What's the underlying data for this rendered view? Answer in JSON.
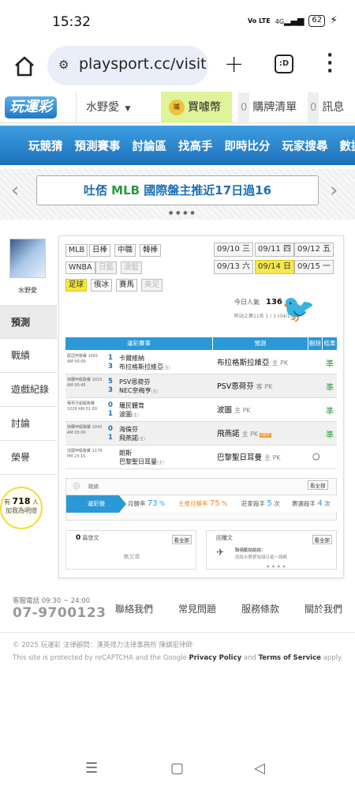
{
  "status_bar": {
    "time": "15:32",
    "network": "Vo LTE",
    "signal": "4G",
    "battery": "62"
  },
  "browser": {
    "url": "playsport.cc/visit",
    "new_tab": "+",
    "tabs": ":D",
    "menu": "⋮"
  },
  "site_header": {
    "logo": "玩運彩",
    "user_select": "水野愛",
    "buy_coin": "買噱幣",
    "coin_icon": "噱",
    "cart_count": "0",
    "cart_label": "購牌清單",
    "msg_count": "0",
    "msg_label": "訊息"
  },
  "nav": {
    "items": [
      "玩競猜",
      "預測賽事",
      "討論區",
      "找高手",
      "即時比分",
      "玩家搜尋",
      "數據"
    ]
  },
  "banner": {
    "prefix": "吐俖 ",
    "highlight": "MLB",
    "text": " 國際盤主推近17日過16",
    "dots": "● ● ● ●"
  },
  "sidebar": {
    "username": "水野愛",
    "tabs": [
      "預測",
      "戰績",
      "遊戲紀錄",
      "討論",
      "榮譽"
    ],
    "bulb_prefix": "有",
    "bulb_count": "718",
    "bulb_suffix": "人",
    "bulb_text": "加我為明燈"
  },
  "leagues": {
    "row1": [
      "MLB",
      "日棒",
      "中職",
      "韓棒"
    ],
    "row2": [
      "WNBA",
      "日籃",
      "澳籃"
    ],
    "row3": [
      "足球",
      "俄冰",
      "賽馬",
      "美足"
    ]
  },
  "dates": {
    "row1": [
      "09/10 三",
      "09/11 四",
      "09/12 五"
    ],
    "row2": [
      "09/13 六",
      "09/14 日",
      "09/15 一"
    ]
  },
  "popularity": {
    "label": "今日人氣",
    "value": "136",
    "rank": "昨站上第11名 1 / 1 (04/15/4)"
  },
  "table": {
    "headers": [
      "運彩賽事",
      "預測",
      "刪除",
      "結果"
    ],
    "rows": [
      {
        "league": "歐冠杯聯賽 1001 AM 00:00",
        "s1": "1",
        "s2": "3",
        "t1": "卡爾維納",
        "t2": "布拉格斯拉維亞",
        "t2_tag": "(主)",
        "pick": "布拉格斯拉維亞",
        "side": "主 PK",
        "hot": "",
        "del": "",
        "result": "準"
      },
      {
        "league": "荷蘭甲級聯賽 1015 AM 00:45",
        "s1": "5",
        "s2": "3",
        "t1": "PSV恩荷芬",
        "t2": "NEC奈梅亨",
        "t2_tag": "(主)",
        "pick": "PSV恩荷芬",
        "side": "客 PK",
        "hot": "",
        "del": "",
        "result": "準"
      },
      {
        "league": "葡萄牙超級聯賽 1029 AM 01:00",
        "s1": "0",
        "s2": "1",
        "t1": "羅民體育",
        "t2": "波圖",
        "t2_tag": "(主)",
        "pick": "波圖",
        "side": "主 PK",
        "hot": "",
        "del": "",
        "result": "準"
      },
      {
        "league": "荷蘭甲級聯賽 1043 AM 03:00",
        "s1": "0",
        "s2": "1",
        "t1": "海倫芬",
        "t2": "飛燕諾",
        "t2_tag": "(主)",
        "pick": "飛燕諾",
        "side": "主 PK",
        "hot": "HOT",
        "del": "",
        "result": "準"
      },
      {
        "league": "法國甲級聯賽 1179 PM 23:15",
        "s1": "",
        "s2": "",
        "t1": "朗斯",
        "t2": "巴黎聖日耳曼",
        "t2_tag": "(主)",
        "pick": "巴黎聖日耳曼",
        "side": "主 PK",
        "hot": "",
        "del": "○",
        "result": ""
      }
    ]
  },
  "stats": {
    "title": "戰績",
    "all_link": "看全部",
    "tab": "運彩盤",
    "items": [
      {
        "label": "月勝率",
        "value": "73",
        "unit": "%",
        "color": "#2b98d8"
      },
      {
        "label": "主推月勝率",
        "value": "75",
        "unit": "%",
        "color": "#f08a2a"
      },
      {
        "label": "莊家殺手",
        "value": "5",
        "unit": "次",
        "color": "#2b98d8"
      },
      {
        "label": "票選殺手",
        "value": "4",
        "unit": "次",
        "color": "#2b98d8"
      }
    ]
  },
  "posts": {
    "count": "0",
    "label": "篇發文",
    "all_link": "看全部",
    "empty": "無文章"
  },
  "replies": {
    "label": "回覆文",
    "all_link": "看全部",
    "title": "聯璃動結結結：",
    "excerpt": "就說水野愛說總日者一總殿"
  },
  "footer": {
    "phone_label": "客服電話 09:30 ~ 24:00",
    "phone": "07-9700123",
    "links": [
      "聯絡我們",
      "常見問題",
      "服務條款",
      "關於我們"
    ],
    "copyright": "© 2025 玩運彩  法律顧問：漢英得力法律事務所 陳鎮宏律師",
    "recaptcha_pre": "This site is protected by reCAPTCHA and the Google ",
    "privacy": "Privacy Policy",
    "and": " and ",
    "terms": "Terms of Service",
    "apply": " apply."
  },
  "android_nav": {
    "recent": "☰",
    "home": "▢",
    "back": "◁"
  }
}
